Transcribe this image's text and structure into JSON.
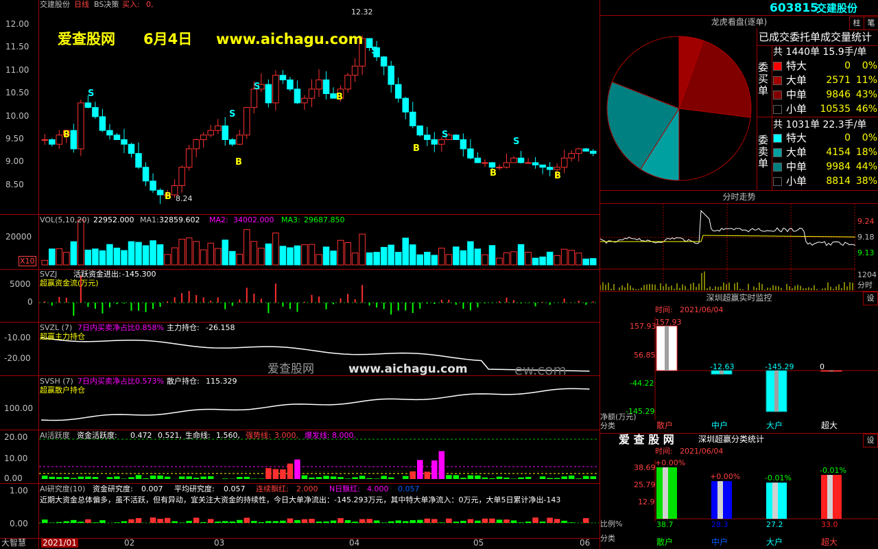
{
  "header": {
    "name": "交建股份",
    "period": "日线",
    "indicator": "BS决策",
    "buy_label": "买入:",
    "buy_value": "0,",
    "code": "603815",
    "code_name": "交建股份",
    "btn_zhu": "柱",
    "btn_notes": "笔"
  },
  "watermark": {
    "site": "爱查股网",
    "date": "6月4日",
    "url": "www.aichagu.com",
    "mid_site": "爱查股网",
    "mid_url": "www.aichagu.com",
    "mid_tail": "ew.com"
  },
  "price_axis": [
    "12.00",
    "11.50",
    "11.00",
    "10.50",
    "10.00",
    "9.50",
    "9.00",
    "8.50"
  ],
  "price_marks": {
    "high": "12.32",
    "low": "8.24"
  },
  "vol": {
    "label": "VOL(5,10,20)",
    "v": "22952.000",
    "ma1_label": "MA1:",
    "ma1": "32859.602",
    "ma2_label": "MA2:",
    "ma2": "34002.000",
    "ma3_label": "MA3:",
    "ma3": "29687.850",
    "axis": "20000",
    "unit": "X10"
  },
  "svzj": {
    "label": "SVZJ",
    "name": "活跃资金进出:",
    "value": "-145.300",
    "sub": "超赢资金流(万元)",
    "axis": [
      "5000",
      "0"
    ]
  },
  "svzl": {
    "label": "SVZL (7)",
    "desc": "7日内买卖净占比0.858%",
    "name": "主力持仓:",
    "value": "-26.158",
    "sub": "超赢主力持仓",
    "axis": [
      "-10.00",
      "-20.00"
    ]
  },
  "svsh": {
    "label": "SVSH (7)",
    "desc": "7日内买卖净占比0.573%",
    "name": "散户持仓:",
    "value": "115.329",
    "sub": "超赢散户持仓",
    "axis": [
      "100.00"
    ]
  },
  "ai_active": {
    "label": "AI活跃度",
    "t1": "资金活跃度:",
    "v1": "0.472",
    "v2": "0.521,",
    "t3": "生命线:",
    "v3": "1.560,",
    "t4": "强势线:",
    "v4": "3.000,",
    "t5": "爆发线:",
    "v5": "8.000,",
    "axis": [
      "20.00",
      "10.00",
      "0.00"
    ]
  },
  "ai_research": {
    "label": "AI研究度(10)",
    "t1": "资金研究度:",
    "v1": "0.007",
    "t2": "平均研究度:",
    "v2": "0.057",
    "t3": "连续飘红:",
    "v3": "2.000",
    "t4": "N日飘红:",
    "v4": "4.000",
    "v5": "0.057",
    "comment": "近期大资金总体偏多，虽不活跃，但有异动，宜关注大资金的持续性，今日大单净流出：-145.293万元，其中特大单净流入：0万元，大单5日累计净出-143",
    "axis": [
      "1.00",
      "0.00"
    ]
  },
  "time_axis": [
    "2021/01",
    "02",
    "03",
    "04",
    "05",
    "06"
  ],
  "brand": "大智慧",
  "dragon": {
    "title": "龙虎看盘(逐单)",
    "subtitle": "已成交委托单成交量统计",
    "buy_side": "委买单",
    "sell_side": "委卖单",
    "buy_total": "共 1440单 15.9手/单",
    "sell_total": "共 1031单 22.3手/单",
    "buy_rows": [
      {
        "name": "特大",
        "count": "0",
        "pct": "0%",
        "color": "#ff0000"
      },
      {
        "name": "大单",
        "count": "2571",
        "pct": "11%",
        "color": "#a00000"
      },
      {
        "name": "中单",
        "count": "9846",
        "pct": "43%",
        "color": "#800000"
      },
      {
        "name": "小单",
        "count": "10535",
        "pct": "46%",
        "color": "#000000"
      }
    ],
    "sell_rows": [
      {
        "name": "特大",
        "count": "0",
        "pct": "0%",
        "color": "#00ffff"
      },
      {
        "name": "大单",
        "count": "4154",
        "pct": "18%",
        "color": "#00a0a0"
      },
      {
        "name": "中单",
        "count": "9984",
        "pct": "44%",
        "color": "#008080"
      },
      {
        "name": "小单",
        "count": "8814",
        "pct": "38%",
        "color": "#000000"
      }
    ]
  },
  "intraday": {
    "title": "分时走势",
    "axis": [
      "9.24",
      "9.18",
      "9.13"
    ],
    "vol": "1204",
    "vol_label": "分时"
  },
  "monitor": {
    "title": "深圳超赢实时监控",
    "btn": "设",
    "time_label": "时间:",
    "time": "2021/06/04",
    "axis": [
      "157.93",
      "56.85",
      "-44.22",
      "-145.29"
    ],
    "unit": "净额(万元)",
    "cat_label": "分类",
    "categories": [
      "散户",
      "中户",
      "大户",
      "超大"
    ],
    "values": [
      157.93,
      -12.63,
      -145.29,
      0
    ],
    "value_labels": [
      "157.93",
      "-12.63",
      "-145.29",
      "0"
    ]
  },
  "classify": {
    "brand": "爱 查 股 网",
    "title": "深圳超赢分类统计",
    "btn": "设",
    "time_label": "时间:",
    "time": "2021/06/04",
    "axis": [
      "38.69",
      "25.79",
      "12.9"
    ],
    "pct_label": "比例%",
    "cat_label": "分类",
    "categories": [
      "散户",
      "中户",
      "大户",
      "超大"
    ],
    "changes": [
      "+0.00%",
      "+0.00%",
      "-0.01%",
      "-0.01%"
    ],
    "values": [
      38.7,
      28.3,
      27.2,
      33.0
    ],
    "value_labels": [
      "38.7",
      "28.3",
      "27.2",
      "33.0"
    ],
    "colors": [
      "#00e000",
      "#0000ff",
      "#00ffff",
      "#ff2020"
    ]
  }
}
